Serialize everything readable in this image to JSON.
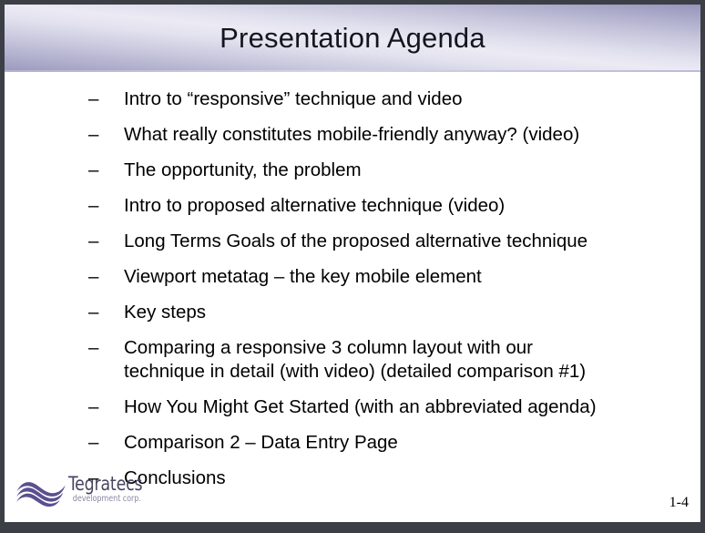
{
  "slide": {
    "title": "Presentation Agenda",
    "page_number": "1-4",
    "frame_color": "#3c4046",
    "title_color": "#14161f",
    "body_text_color": "#000000",
    "accent_color": "#5b4f8e",
    "header_gradient_light": "#eceaf4",
    "header_gradient_dark": "#9694ba"
  },
  "agenda": {
    "bullet_glyph": "–",
    "items": [
      {
        "label": "Intro to “responsive” technique and video"
      },
      {
        "label": "What really constitutes mobile-friendly anyway? (video)"
      },
      {
        "label": "The opportunity, the problem"
      },
      {
        "label": "Intro to proposed alternative technique (video)"
      },
      {
        "label": "Long Terms Goals of the proposed alternative technique"
      },
      {
        "label": "Viewport metatag – the key mobile element"
      },
      {
        "label": "Key steps"
      },
      {
        "label": "Comparing a responsive 3 column layout with our\ntechnique in detail (with video) (detailed comparison #1)"
      },
      {
        "label": "How You Might Get Started (with an abbreviated agenda)"
      },
      {
        "label": "Comparison 2 – Data Entry Page"
      },
      {
        "label": "Conclusions"
      }
    ]
  },
  "logo": {
    "name": "Tegratecs",
    "tagline": "development corp.",
    "mark_color": "#5b4f8e"
  }
}
